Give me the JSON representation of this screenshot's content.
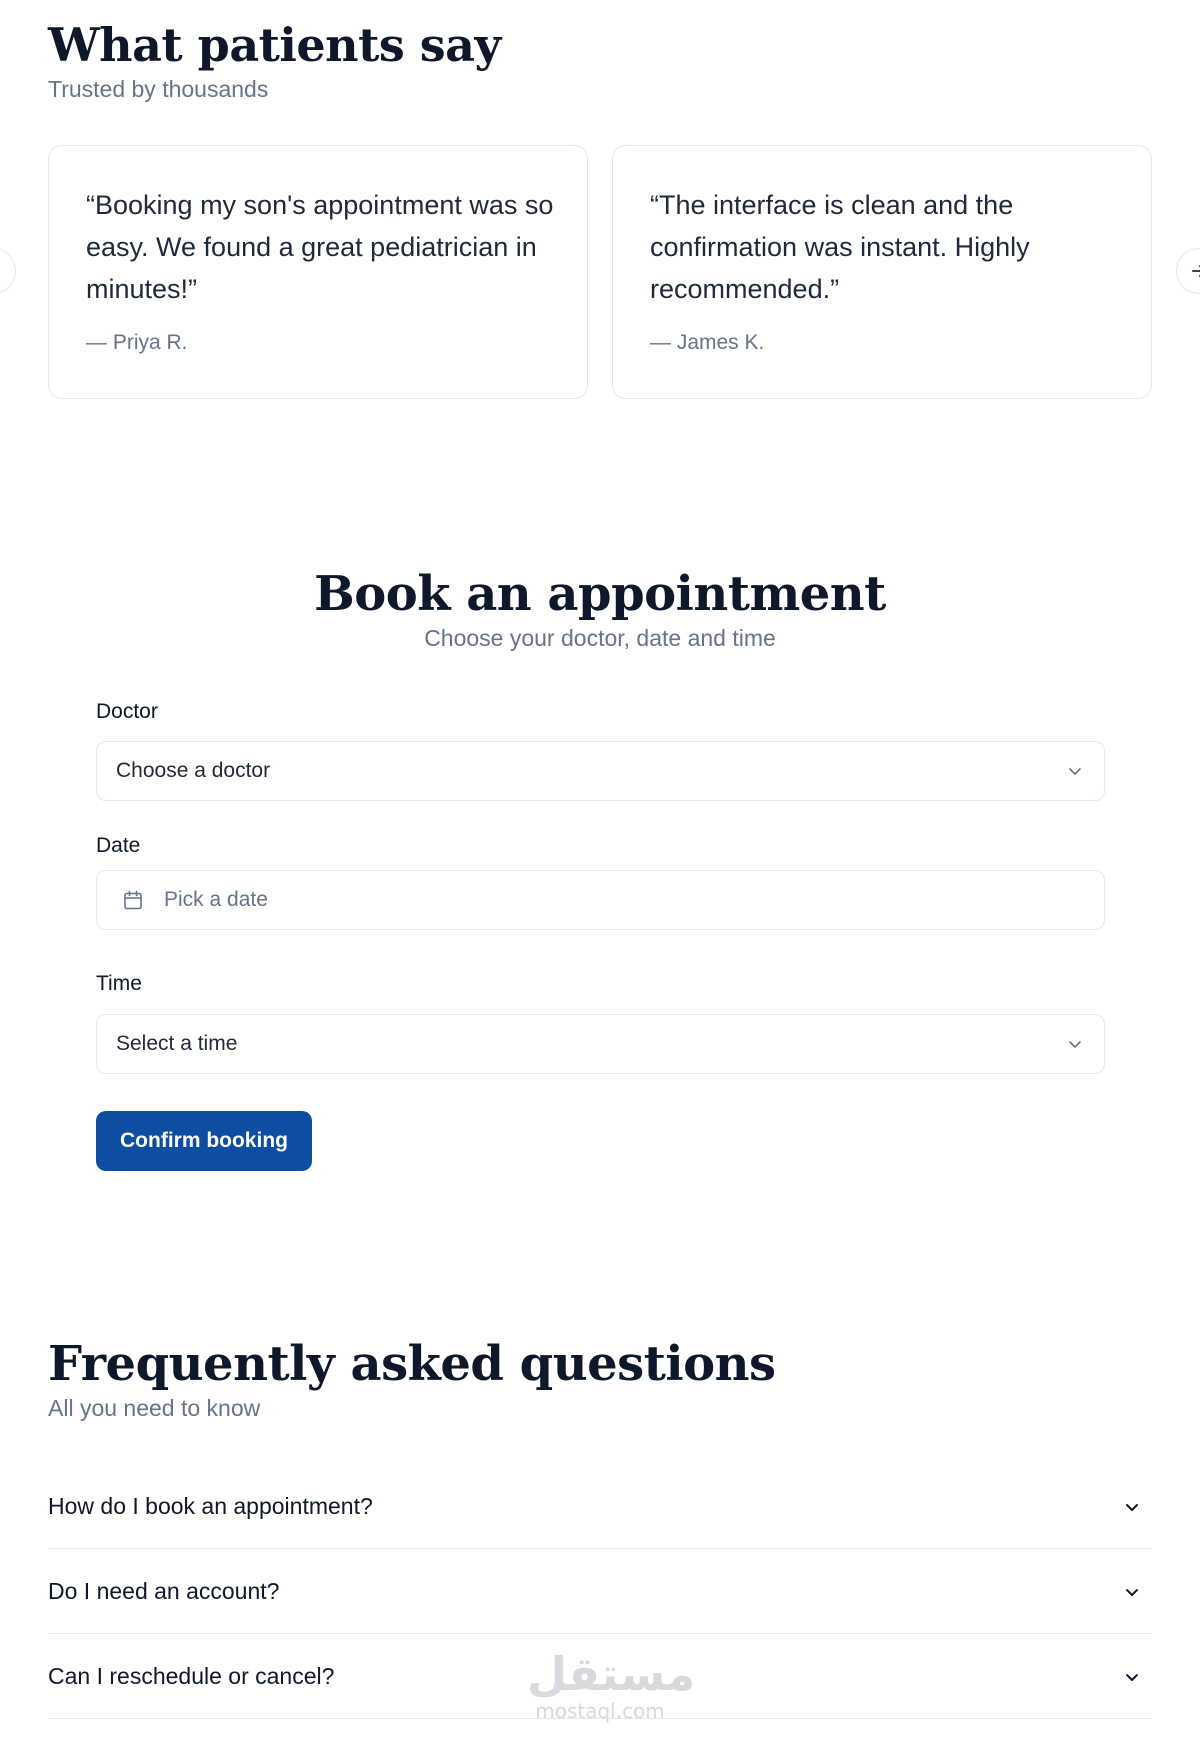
{
  "testimonials": {
    "title": "What patients say",
    "subtitle": "Trusted by thousands",
    "items": [
      {
        "quote": "“Booking my son's appointment was so easy. We found a great pediatrician in minutes!”",
        "author": "— Priya R."
      },
      {
        "quote": "“The interface is clean and the confirmation was instant. Highly recommended.”",
        "author": "— James K."
      }
    ],
    "prev_icon": "arrow-left-icon",
    "next_icon": "arrow-right-icon"
  },
  "booking": {
    "title": "Book an appointment",
    "subtitle": "Choose your doctor, date and time",
    "doctor": {
      "label": "Doctor",
      "value": "Choose a doctor"
    },
    "date": {
      "label": "Date",
      "placeholder": "Pick a date"
    },
    "time": {
      "label": "Time",
      "value": "Select a time"
    },
    "confirm_label": "Confirm booking",
    "accent": "#0d4ea3"
  },
  "faq": {
    "title": "Frequently asked questions",
    "subtitle": "All you need to know",
    "items": [
      {
        "question": "How do I book an appointment?"
      },
      {
        "question": "Do I need an account?"
      },
      {
        "question": "Can I reschedule or cancel?"
      }
    ]
  },
  "watermark": {
    "arabic": "مستقل",
    "latin": "mostaql.com"
  }
}
